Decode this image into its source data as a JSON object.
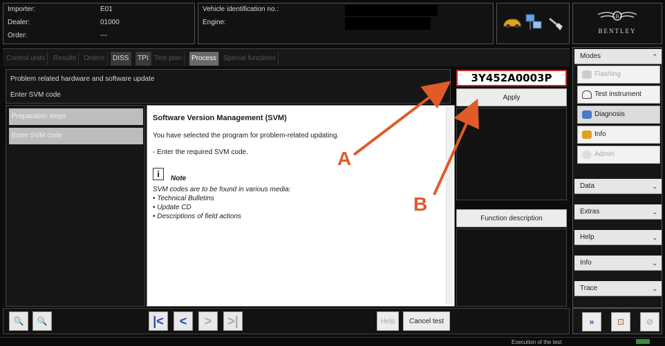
{
  "header": {
    "importer_label": "Importer:",
    "importer_value": "E01",
    "dealer_label": "Dealer:",
    "dealer_value": "01000",
    "order_label": "Order:",
    "order_value": "---",
    "vin_label": "Vehicle identification no.:",
    "engine_label": "Engine:",
    "brand": "BENTLEY"
  },
  "tabs": [
    {
      "label": "Control units"
    },
    {
      "label": "Results"
    },
    {
      "label": "Orders"
    },
    {
      "label": "DISS"
    },
    {
      "label": "TPI"
    },
    {
      "label": "Test plan"
    },
    {
      "label": "Process"
    },
    {
      "label": "Special functions"
    }
  ],
  "title": {
    "line1": "Problem related hardware and software update",
    "line2": "Enter SVM code"
  },
  "svm_input": {
    "value": "3Y452A0003P"
  },
  "apply_label": "Apply",
  "function_description_label": "Function description",
  "steps": [
    {
      "label": "Preparation steps"
    },
    {
      "label": "Enter SVM code"
    }
  ],
  "content": {
    "heading": "Software Version Management (SVM)",
    "para1": "You have selected the program for problem-related updating.",
    "para2": "- Enter the required SVM code.",
    "note_title": "Note",
    "note_text": "SVM codes are to be found in various media:",
    "bullets": [
      "Technical Bulletins",
      "Update CD",
      "Descriptions of field actions"
    ]
  },
  "sidebar": {
    "modes_label": "Modes",
    "modes": [
      {
        "label": "Flashing",
        "enabled": false
      },
      {
        "label": "Test instrument",
        "enabled": true
      },
      {
        "label": "Diagnosis",
        "enabled": true
      },
      {
        "label": "Info",
        "enabled": true
      },
      {
        "label": "Admin",
        "enabled": false
      }
    ],
    "sections": [
      {
        "label": "Data"
      },
      {
        "label": "Extras"
      },
      {
        "label": "Help"
      },
      {
        "label": "Info"
      },
      {
        "label": "Trace"
      }
    ]
  },
  "bottom": {
    "help_label": "Help",
    "cancel_label": "Cancel test"
  },
  "annotations": {
    "a": "A",
    "b": "B"
  },
  "status": {
    "text": "Execution of the test"
  },
  "colors": {
    "arrow": "#e05a2a",
    "highlight_border": "#c8282a"
  }
}
